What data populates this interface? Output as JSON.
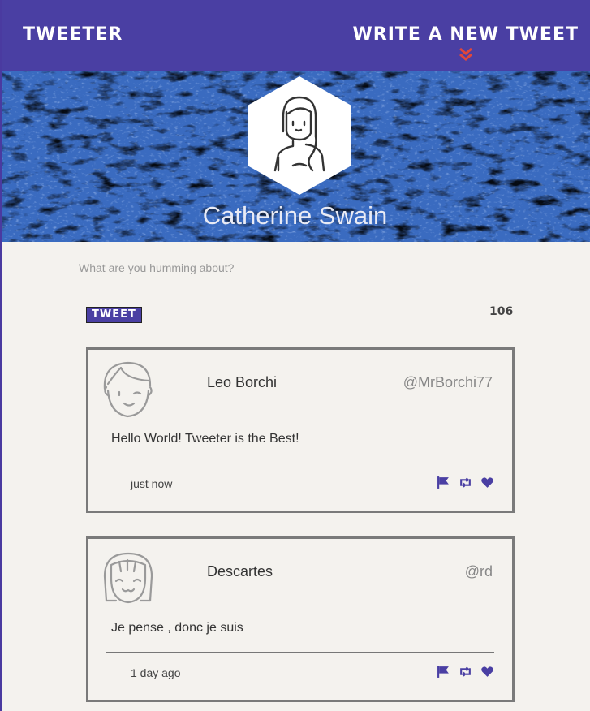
{
  "nav": {
    "brand": "TWEETER",
    "compose_label": "WRITE A NEW TWEET"
  },
  "profile": {
    "name": "Catherine Swain"
  },
  "composer": {
    "placeholder": "What are you humming about?",
    "button_label": "TWEET",
    "char_count": "106"
  },
  "tweets": [
    {
      "author": "Leo Borchi",
      "handle": "@MrBorchi77",
      "text": "Hello World! Tweeter is the Best!",
      "time": "just now"
    },
    {
      "author": "Descartes",
      "handle": "@rd",
      "text": "Je pense , donc je suis",
      "time": "1 day ago"
    }
  ],
  "colors": {
    "brand_purple": "#4a3fa3",
    "arrow_red": "#e0473b",
    "background": "#f4f2ee"
  },
  "icons": [
    "chevron-double-down-icon",
    "flag-icon",
    "retweet-icon",
    "heart-icon"
  ]
}
